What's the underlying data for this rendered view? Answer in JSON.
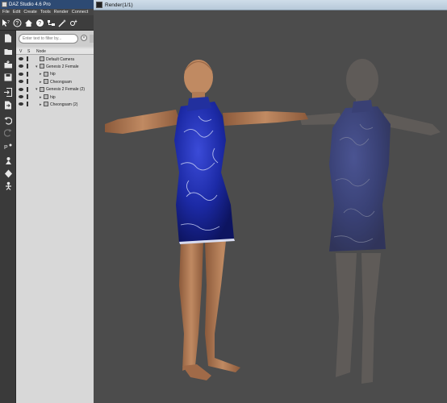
{
  "app": {
    "title": "DAZ Studio 4.6 Pro",
    "menu": [
      "File",
      "Edit",
      "Create",
      "Tools",
      "Render",
      "Connect"
    ]
  },
  "quick_icons": [
    "help-cursor-icon",
    "help-icon",
    "home-icon",
    "question-icon",
    "scene-tree-icon",
    "magic-wand-icon",
    "sparkle-icon"
  ],
  "tools": [
    "new-file-icon",
    "open-folder-icon",
    "merge-icon",
    "save-icon",
    "import-icon",
    "export-icon",
    "undo-icon",
    "redo-icon",
    "pose-tool-icon",
    "universal-tool-icon",
    "node-weight-icon",
    "joint-editor-icon"
  ],
  "scene": {
    "filter_placeholder": "Enter text to filter by...",
    "columns": {
      "v": "V",
      "s": "S",
      "node": "Node"
    },
    "nodes": [
      {
        "label": "Default Camera",
        "depth": 0,
        "icon": "camera-icon"
      },
      {
        "label": "Genesis 2 Female",
        "depth": 0,
        "icon": "figure-icon"
      },
      {
        "label": "hip",
        "depth": 1,
        "icon": "bone-icon"
      },
      {
        "label": "Cheongsam",
        "depth": 1,
        "icon": "figure-icon"
      },
      {
        "label": "Genesis 2 Female (2)",
        "depth": 0,
        "icon": "figure-icon"
      },
      {
        "label": "hip",
        "depth": 1,
        "icon": "bone-icon"
      },
      {
        "label": "Cheongsam (2)",
        "depth": 1,
        "icon": "figure-icon"
      }
    ]
  },
  "render": {
    "title": "Render(1/1)"
  },
  "colors": {
    "titlebar": "#2d4a73",
    "dress": "#1c2aa6",
    "skin": "#b07a54",
    "background": "#4c4c4c"
  }
}
